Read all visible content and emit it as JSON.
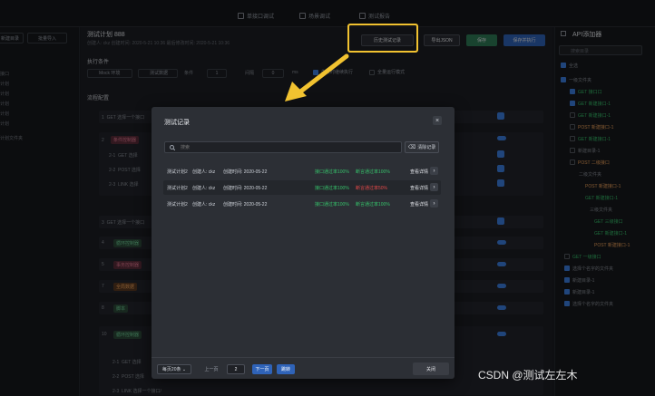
{
  "top_tabs": [
    {
      "label": "单接口调试"
    },
    {
      "label": "场景调试"
    },
    {
      "label": "测试报告"
    }
  ],
  "left": {
    "buttons": [
      "新建目录",
      "批量导入"
    ],
    "rows": [
      "接口",
      "计划",
      "计划",
      "计划",
      "计划",
      "计划",
      "计划文件夹"
    ]
  },
  "plan": {
    "title": "测试计划 888",
    "meta": "创建人: ckz   创建时间: 2020-5-21 10:36   最后修改时间: 2020-5-21 10:36",
    "buttons": {
      "history": "历史测试记录",
      "export": "导出JSON",
      "save": "保存",
      "run": "保存并执行"
    },
    "exec_section": "执行条件",
    "exec_fields": [
      "Mock 环境",
      "测试数据",
      "条件",
      "1",
      "间隔",
      "0",
      "ms",
      "失败时继续执行",
      "全量运行模式"
    ],
    "flow_section": "流程配置",
    "flow_rows": [
      {
        "num": "1",
        "text": "GET  选择一个接口"
      },
      {
        "num": "2",
        "text": "条件控制器"
      },
      {
        "num": "2-1",
        "text": "GET  选择"
      },
      {
        "num": "2-2",
        "text": "POST  选择"
      },
      {
        "num": "2-3",
        "text": "LINK  选择"
      },
      {
        "num": "3",
        "text": "GET  选择一个接口"
      },
      {
        "num": "4",
        "text": "循环控制器"
      },
      {
        "num": "5",
        "text": "事务控制器"
      },
      {
        "num": "7",
        "text": "全局数据"
      },
      {
        "num": "8",
        "text": "脚本"
      },
      {
        "num": "10",
        "text": "循环控制器"
      },
      {
        "num": "2-1",
        "text": "GET  选择"
      },
      {
        "num": "2-2",
        "text": "POST  选择"
      },
      {
        "num": "2-3",
        "text": "LINK  选择一个接口/"
      }
    ]
  },
  "right": {
    "title": "API添加器",
    "search_placeholder": "搜索目录",
    "items": [
      "全选",
      "一级文件夹",
      "GET  接口口",
      "GET  新建接口-1",
      "GET  新建接口-1",
      "POST  新建接口-1",
      "GET  新建接口-1",
      "新建目录-1",
      "POST  二级接口",
      "二级文件夹",
      "POST  新建接口-1",
      "GET  新建接口-1",
      "三级文件夹",
      "GET  三级接口",
      "GET  新建接口-1",
      "POST  新建接口-1",
      "GET  一级接口",
      "选择个名字的文件夹",
      "新建目录-1",
      "新建目录-1",
      "选择个名字的文件夹"
    ]
  },
  "modal": {
    "title": "测试记录",
    "search_placeholder": "搜索",
    "clear_label": "清除记录",
    "records": [
      {
        "name": "测试计划2",
        "creator": "创建人: ckz",
        "time": "创建时间: 2020-05-22",
        "pass1": "接口通过率100%",
        "pass2": "断言通过率100%",
        "pass2_color": "#36c06a",
        "detail": "查看详情"
      },
      {
        "name": "测试计划2",
        "creator": "创建人: ckz",
        "time": "创建时间: 2020-05-22",
        "pass1": "接口通过率100%",
        "pass2": "断言通过率50%",
        "pass2_color": "#e04848",
        "detail": "查看详情"
      },
      {
        "name": "测试计划2",
        "creator": "创建人: ckz",
        "time": "创建时间: 2020-05-22",
        "pass1": "接口通过率100%",
        "pass2": "断言通过率100%",
        "pass2_color": "#36c06a",
        "detail": "查看详情"
      }
    ],
    "page_size": "每页20条",
    "prev": "上一页",
    "page": "2",
    "next": "下一页",
    "jump": "跳转",
    "close": "关闭"
  },
  "watermark": "CSDN @测试左左木",
  "colors": {
    "accent": "#3b7fe0",
    "highlight": "#f1c230",
    "success": "#36c06a",
    "danger": "#e04848"
  }
}
